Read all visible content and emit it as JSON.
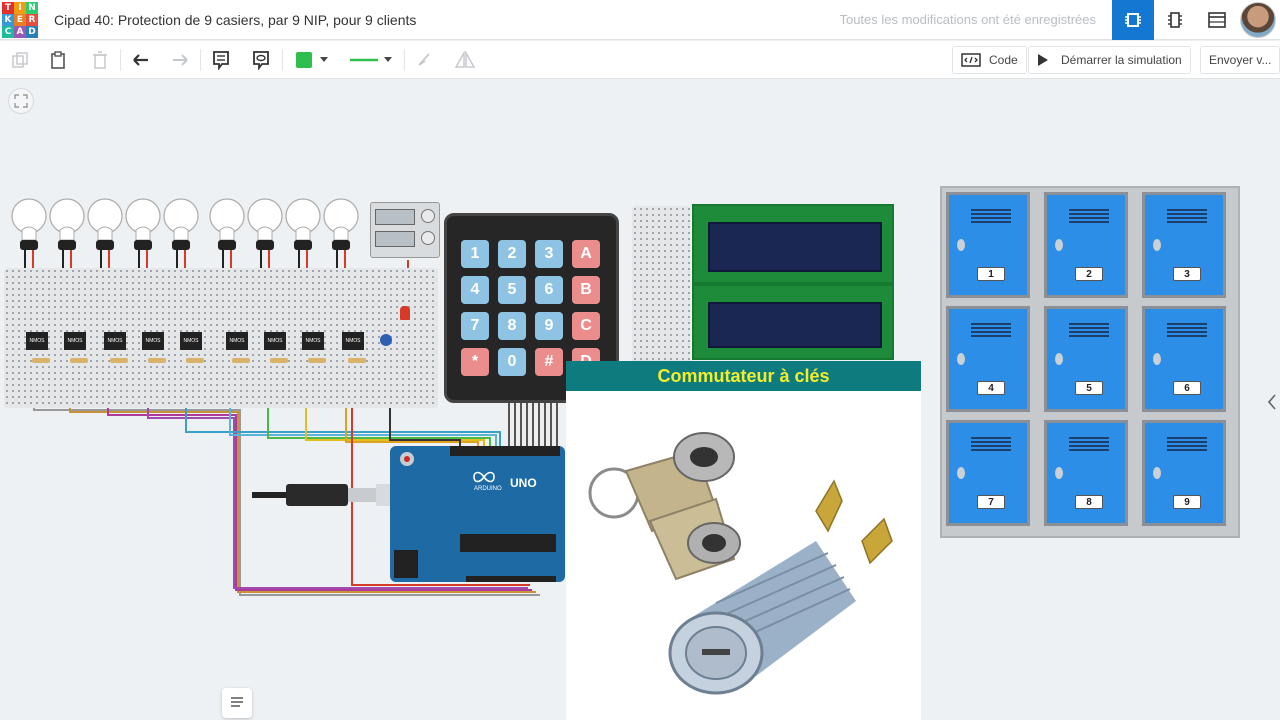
{
  "app": {
    "logo_letters": [
      "T",
      "I",
      "N",
      "K",
      "E",
      "R",
      "C",
      "A",
      "D"
    ],
    "title": "Cipad 40: Protection de 9 casiers, par 9 NIP, pour 9 clients",
    "saved_status": "Toutes les modifications ont été enregistrées"
  },
  "toolbar": {
    "code_label": "Code",
    "simulate_label": "Démarrer la simulation",
    "send_label": "Envoyer v...",
    "wire_color": "#2ebf4e"
  },
  "keypad": {
    "keys": [
      "1",
      "2",
      "3",
      "A",
      "4",
      "5",
      "6",
      "B",
      "7",
      "8",
      "9",
      "C",
      "*",
      "0",
      "#",
      "D"
    ]
  },
  "arduino": {
    "brand": "ARDUINO",
    "model": "UNO"
  },
  "popup": {
    "title": "Commutateur à clés"
  },
  "lockers": {
    "numbers": [
      "1",
      "2",
      "3",
      "4",
      "5",
      "6",
      "7",
      "8",
      "9"
    ]
  },
  "transistor_label": "NMOS"
}
